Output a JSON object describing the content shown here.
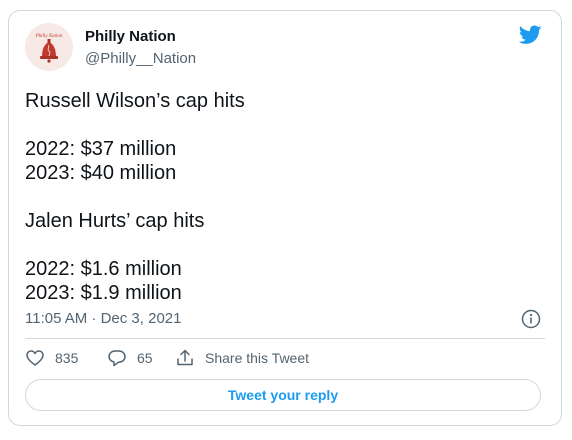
{
  "account": {
    "name": "Philly Nation",
    "handle": "@Philly__Nation",
    "avatar_icon": "liberty-bell-logo-icon",
    "avatar_logo_text": "Philly Nation"
  },
  "brand": {
    "icon": "twitter-bird-icon",
    "color": "#1d9bf0"
  },
  "tweet": {
    "lines": [
      "Russell Wilson’s cap hits",
      "",
      "2022: $37 million",
      "2023: $40 million",
      "",
      "Jalen Hurts’ cap hits",
      "",
      "2022: $1.6 million",
      "2023: $1.9 million"
    ],
    "timestamp": "11:05 AM · Dec 3, 2021"
  },
  "actions": {
    "likes": "835",
    "replies": "65",
    "share_label": "Share this Tweet"
  },
  "reply_button_label": "Tweet your reply",
  "icons": {
    "info": "info-icon",
    "heart": "heart-icon",
    "comment": "comment-icon",
    "share": "share-icon"
  }
}
